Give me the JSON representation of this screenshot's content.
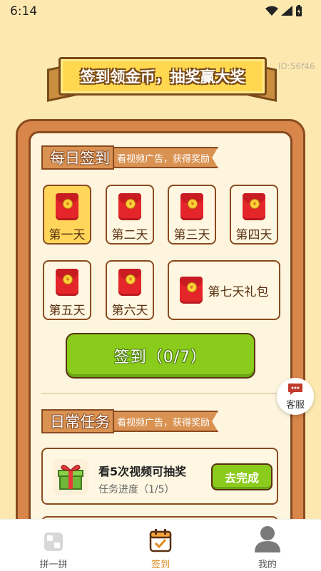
{
  "status_bar": {
    "time": "6:14"
  },
  "banner": {
    "title": "签到领金币，抽奖赢大奖",
    "user_id": "ID:56f46"
  },
  "daily_checkin": {
    "title": "每日签到",
    "subtitle": "看视频广告，获得奖励",
    "coin_symbol": "¥",
    "days": [
      {
        "label": "第一天",
        "active": true
      },
      {
        "label": "第二天",
        "active": false
      },
      {
        "label": "第三天",
        "active": false
      },
      {
        "label": "第四天",
        "active": false
      },
      {
        "label": "第五天",
        "active": false
      },
      {
        "label": "第六天",
        "active": false
      },
      {
        "label": "第七天礼包",
        "active": false
      }
    ],
    "signin_button": "签到（0/7）"
  },
  "daily_tasks": {
    "title": "日常任务",
    "subtitle": "看视频广告，获得奖励",
    "tasks": [
      {
        "title": "看5次视频可抽奖",
        "progress": "任务进度（1/5）",
        "action": "去完成"
      }
    ]
  },
  "customer_service": {
    "label": "客服"
  },
  "bottom_nav": {
    "items": [
      {
        "label": "拼一拼",
        "icon": "puzzle-icon",
        "active": false
      },
      {
        "label": "签到",
        "icon": "calendar-check-icon",
        "active": true
      },
      {
        "label": "我的",
        "icon": "user-icon",
        "active": false
      }
    ]
  },
  "colors": {
    "accent_green": "#8acb1c",
    "brand_orange": "#d8864a",
    "active_tab": "#e08a1e"
  }
}
